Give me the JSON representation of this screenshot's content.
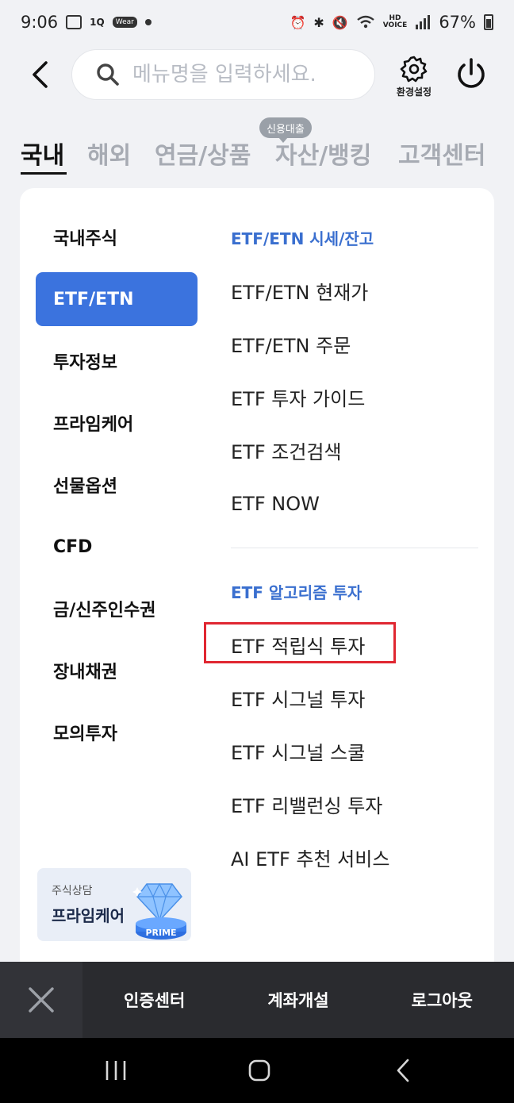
{
  "status_bar": {
    "time": "9:06",
    "battery": "67%",
    "left_icons": [
      "gallery-icon",
      "1q-icon",
      "wear-icon",
      "dot-icon"
    ],
    "right_icons": [
      "alarm-icon",
      "bluetooth-icon",
      "mute-icon",
      "wifi-icon",
      "hd-voice-icon",
      "signal-icon",
      "battery-icon"
    ]
  },
  "header": {
    "search_placeholder": "메뉴명을 입력하세요.",
    "settings_label": "환경설정"
  },
  "category_tabs": [
    {
      "label": "국내",
      "active": true
    },
    {
      "label": "해외",
      "active": false
    },
    {
      "label": "연금/상품",
      "active": false
    },
    {
      "label": "자산/뱅킹",
      "active": false,
      "badge": "신용대출"
    },
    {
      "label": "고객센터",
      "active": false
    }
  ],
  "left_nav": [
    {
      "label": "국내주식",
      "active": false
    },
    {
      "label": "ETF/ETN",
      "active": true
    },
    {
      "label": "투자정보",
      "active": false
    },
    {
      "label": "프라임케어",
      "active": false
    },
    {
      "label": "선물옵션",
      "active": false
    },
    {
      "label": "CFD",
      "active": false
    },
    {
      "label": "금/신주인수권",
      "active": false
    },
    {
      "label": "장내채권",
      "active": false
    },
    {
      "label": "모의투자",
      "active": false
    }
  ],
  "right_sections": [
    {
      "title": "ETF/ETN 시세/잔고",
      "items": [
        "ETF/ETN 현재가",
        "ETF/ETN 주문",
        "ETF 투자 가이드",
        "ETF 조건검색",
        "ETF NOW"
      ]
    },
    {
      "title": "ETF 알고리즘 투자",
      "items": [
        "ETF 적립식 투자",
        "ETF 시그널 투자",
        "ETF 시그널 스쿨",
        "ETF 리밸런싱 투자",
        "AI ETF 추천 서비스"
      ],
      "highlighted_item": "ETF 적립식 투자"
    }
  ],
  "prime_banner": {
    "subtitle": "주식상담",
    "title": "프라임케어",
    "badge": "PRIME"
  },
  "bottom_bar": {
    "links": [
      "인증센터",
      "계좌개설",
      "로그아웃"
    ]
  },
  "colors": {
    "accent": "#3b73de",
    "section_title": "#3a6fcf",
    "highlight": "#e02731",
    "bottom_bar": "#2a2b2f"
  }
}
